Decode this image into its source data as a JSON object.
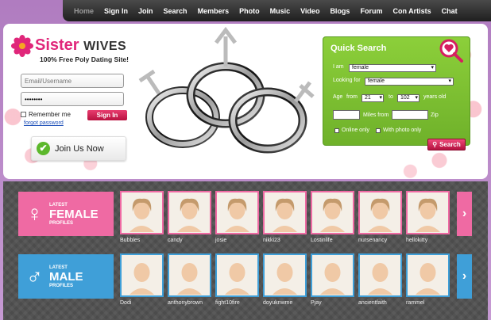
{
  "nav": {
    "items": [
      "Home",
      "Sign In",
      "Join",
      "Search",
      "Members",
      "Photo",
      "Music",
      "Video",
      "Blogs",
      "Forum",
      "Con Artists",
      "Chat"
    ]
  },
  "logo": {
    "title_part1": "Sister",
    "title_part2": "WIVES",
    "tagline": "100% Free Poly Dating Site!"
  },
  "login": {
    "username_placeholder": "Email/Username",
    "password_value": "••••••••",
    "remember_label": "Remember me",
    "forgot_label": "forgot password",
    "signin_label": "Sign In",
    "join_label": "Join Us Now"
  },
  "quick_search": {
    "title": "Quick Search",
    "i_am_label": "I am",
    "i_am_value": "female",
    "looking_for_label": "Looking for",
    "looking_for_value": "female",
    "age_label": "Age",
    "from_label": "from",
    "age_from": "21",
    "to_label": "to",
    "age_to": "102",
    "years_old_label": "years old",
    "miles_from_label": "Miles from",
    "zip_label": "Zip",
    "online_only_label": "Online only",
    "with_photo_label": "With photo only",
    "search_label": "Search"
  },
  "female_section": {
    "latest": "LATEST",
    "gender": "FEMALE",
    "profiles": "PROFILES",
    "names": [
      "Bubbles",
      "candy",
      "josie",
      "nikki23",
      "Lostinlife",
      "nursenancy",
      "hellokitty"
    ]
  },
  "male_section": {
    "latest": "LATEST",
    "gender": "MALE",
    "profiles": "PROFILES",
    "names": [
      "Dodi",
      "anthonybrown",
      "fight10fire",
      "doyuknwme",
      "Pjay",
      "ancientfaith",
      "rammel"
    ]
  },
  "colors": {
    "pink": "#ef6aa3",
    "blue": "#3f9fd8",
    "green": "#7cc232",
    "magenta": "#e0267a"
  },
  "icons": {
    "female": "♀",
    "male": "♂",
    "next": "›",
    "check": "✔",
    "magnifier_heart": "search-heart-icon"
  }
}
